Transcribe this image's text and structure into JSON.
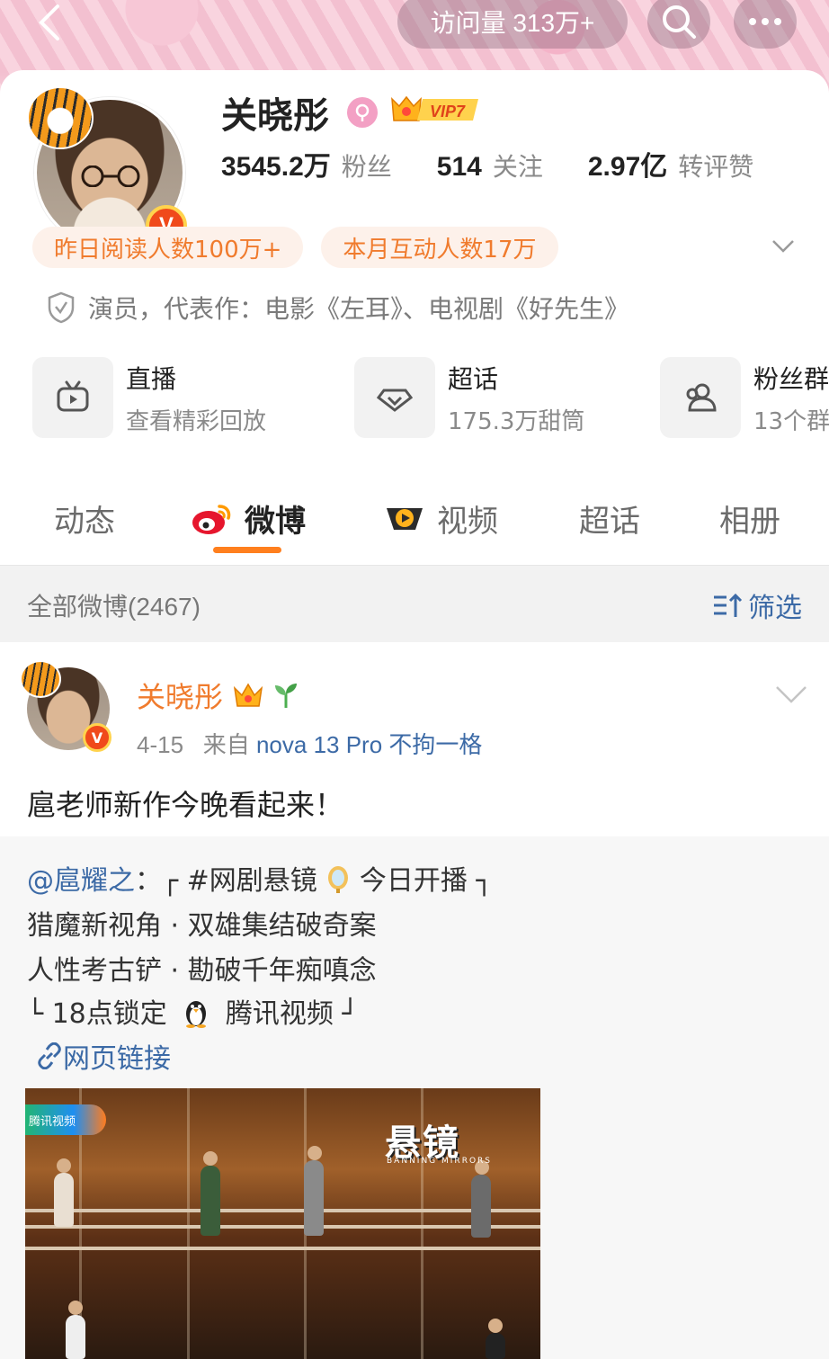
{
  "header": {
    "visits": "访问量 313万+"
  },
  "profile": {
    "name": "关晓彤",
    "vip": "VIP7",
    "stats": [
      {
        "num": "3545.2万",
        "label": "粉丝"
      },
      {
        "num": "514",
        "label": "关注"
      },
      {
        "num": "2.97亿",
        "label": "转评赞"
      }
    ],
    "chips": [
      "昨日阅读人数100万+",
      "本月互动人数17万"
    ],
    "verified": "演员，代表作：电影《左耳》、电视剧《好先生》"
  },
  "features": [
    {
      "title": "直播",
      "sub": "查看精彩回放",
      "icon": "tv-icon"
    },
    {
      "title": "超话",
      "sub": "175.3万甜筒",
      "icon": "diamond-icon"
    },
    {
      "title": "粉丝群",
      "sub": "13个群",
      "icon": "group-icon"
    }
  ],
  "tabs": [
    "动态",
    "微博",
    "视频",
    "超话",
    "相册"
  ],
  "active_tab": "微博",
  "feed": {
    "title": "全部微博(2467)",
    "filter": "筛选"
  },
  "post": {
    "author": "关晓彤",
    "date": "4-15",
    "source_prefix": "来自",
    "device": "nova 13 Pro 不拘一格",
    "text": "扈老师新作今晚看起来！",
    "repost": {
      "mention": "@扈耀之",
      "line1_rest": "：┌ #网剧悬镜",
      "line1_end": "今日开播 ┐",
      "line2": "猎魔新视角 · 双雄集结破奇案",
      "line3": "人性考古铲 · 勘破千年痴嗔念",
      "line4_start": "└ 18点锁定",
      "line4_end": "腾讯视频 ┘",
      "link": "网页链接"
    },
    "poster": {
      "logo": "腾讯视频",
      "title": "悬镜",
      "subtitle": "BANNING MIRRORS"
    }
  },
  "colors": {
    "accent_orange": "#f07b2d",
    "link_blue": "#3c6aa6",
    "tab_indicator": "#ff7f1e"
  }
}
